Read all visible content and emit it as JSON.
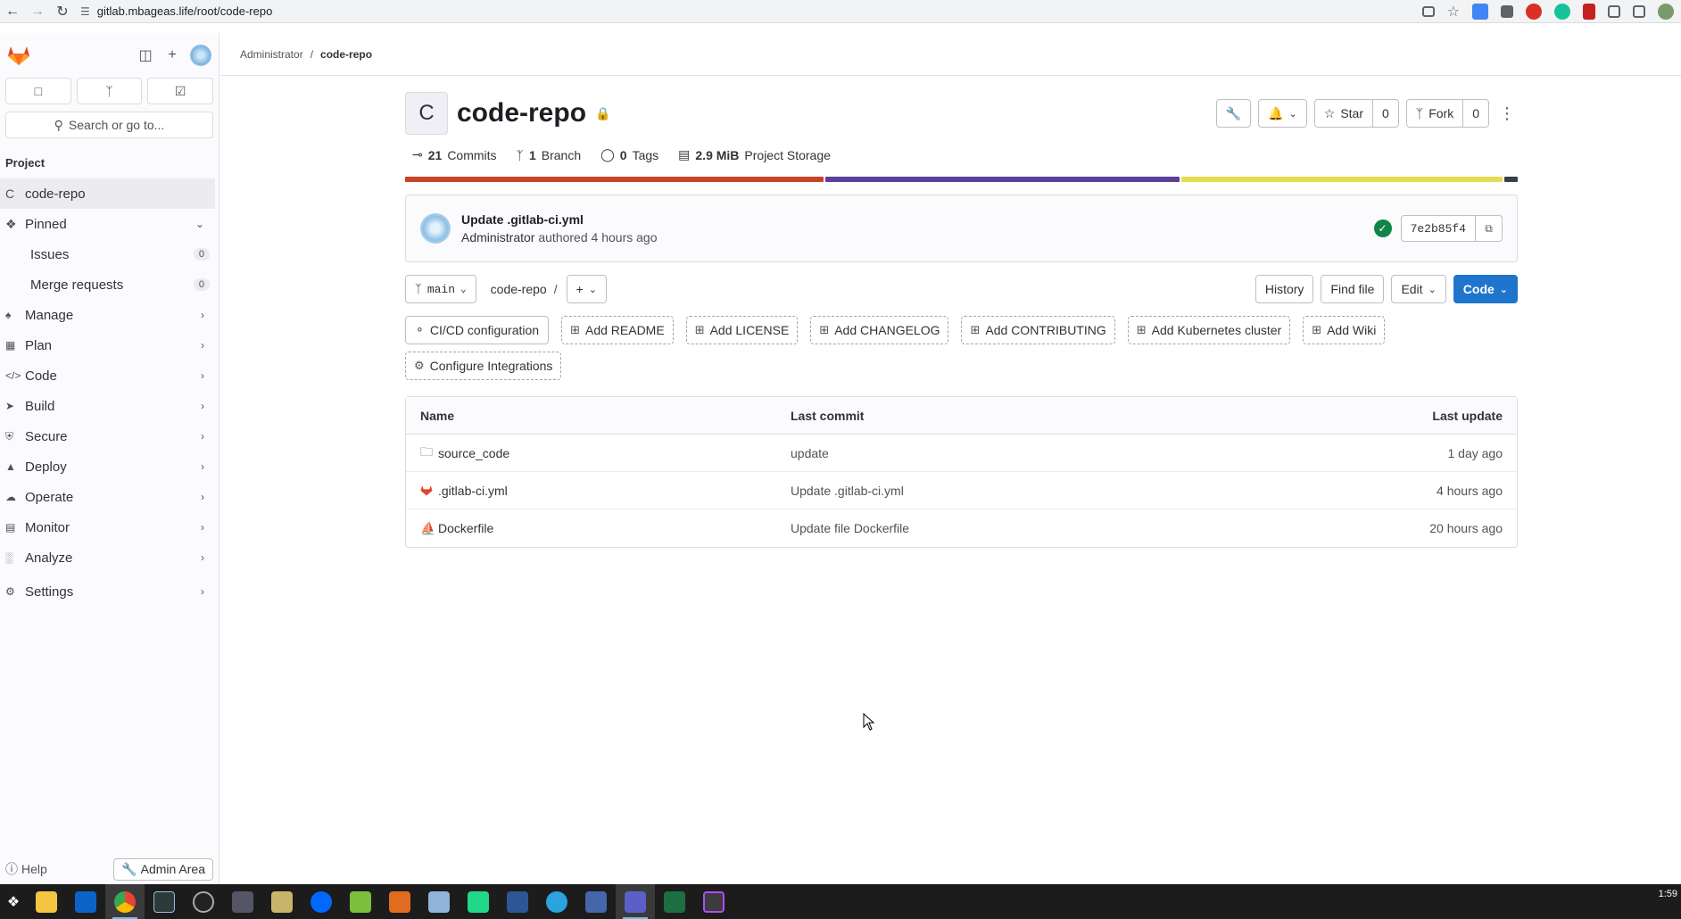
{
  "browser": {
    "url": "gitlab.mbageas.life/root/code-repo"
  },
  "sidebar": {
    "search_label": "Search or go to...",
    "section_label": "Project",
    "project_item": {
      "letter": "C",
      "label": "code-repo"
    },
    "pinned": {
      "label": "Pinned",
      "items": [
        {
          "label": "Issues",
          "count": "0"
        },
        {
          "label": "Merge requests",
          "count": "0"
        }
      ]
    },
    "menu": [
      {
        "label": "Manage",
        "icon": "users-icon"
      },
      {
        "label": "Plan",
        "icon": "plan-icon"
      },
      {
        "label": "Code",
        "icon": "code-icon"
      },
      {
        "label": "Build",
        "icon": "rocket-icon"
      },
      {
        "label": "Secure",
        "icon": "shield-icon"
      },
      {
        "label": "Deploy",
        "icon": "deploy-icon"
      },
      {
        "label": "Operate",
        "icon": "cloud-icon"
      },
      {
        "label": "Monitor",
        "icon": "monitor-icon"
      },
      {
        "label": "Analyze",
        "icon": "chart-icon"
      },
      {
        "label": "Settings",
        "icon": "gear-icon"
      }
    ],
    "help_label": "Help",
    "admin_label": "Admin Area"
  },
  "breadcrumb": {
    "parent": "Administrator",
    "separator": "/",
    "current": "code-repo"
  },
  "project": {
    "avatar_letter": "C",
    "name": "code-repo",
    "star_label": "Star",
    "star_count": "0",
    "fork_label": "Fork",
    "fork_count": "0",
    "stats": {
      "commits_count": "21",
      "commits_label": "Commits",
      "branches_count": "1",
      "branches_label": "Branch",
      "tags_count": "0",
      "tags_label": "Tags",
      "storage_size": "2.9 MiB",
      "storage_label": "Project Storage"
    },
    "languages": [
      {
        "color": "#c7442a",
        "share": 0.378
      },
      {
        "color": "#5c3f9a",
        "share": 0.32
      },
      {
        "color": "#e5dc53",
        "share": 0.29
      },
      {
        "color": "#3a4047",
        "share": 0.012
      }
    ]
  },
  "last_commit": {
    "title": "Update .gitlab-ci.yml",
    "author": "Administrator",
    "authored_label": "authored",
    "time": "4 hours ago",
    "sha": "7e2b85f4"
  },
  "repo_bar": {
    "branch": "main",
    "path": "code-repo",
    "path_sep": "/",
    "add_label": "+",
    "history_label": "History",
    "find_file_label": "Find file",
    "edit_label": "Edit",
    "code_label": "Code"
  },
  "shortcuts": [
    {
      "label": "CI/CD configuration",
      "icon": "pipeline-icon",
      "dashed": false
    },
    {
      "label": "Add README",
      "icon": "plus-square-icon",
      "dashed": true
    },
    {
      "label": "Add LICENSE",
      "icon": "plus-square-icon",
      "dashed": true
    },
    {
      "label": "Add CHANGELOG",
      "icon": "plus-square-icon",
      "dashed": true
    },
    {
      "label": "Add CONTRIBUTING",
      "icon": "plus-square-icon",
      "dashed": true
    },
    {
      "label": "Add Kubernetes cluster",
      "icon": "plus-square-icon",
      "dashed": true
    },
    {
      "label": "Add Wiki",
      "icon": "plus-square-icon",
      "dashed": true
    },
    {
      "label": "Configure Integrations",
      "icon": "gear-icon",
      "dashed": true
    }
  ],
  "files": {
    "headers": {
      "name": "Name",
      "last_commit": "Last commit",
      "last_update": "Last update"
    },
    "rows": [
      {
        "name": "source_code",
        "icon": "folder-icon",
        "commit": "update",
        "updated": "1 day ago"
      },
      {
        "name": ".gitlab-ci.yml",
        "icon": "gitlab-icon",
        "commit": "Update .gitlab-ci.yml",
        "updated": "4 hours ago"
      },
      {
        "name": "Dockerfile",
        "icon": "docker-icon",
        "commit": "Update file Dockerfile",
        "updated": "20 hours ago"
      }
    ]
  },
  "taskbar": {
    "clock_time": "1:59"
  }
}
